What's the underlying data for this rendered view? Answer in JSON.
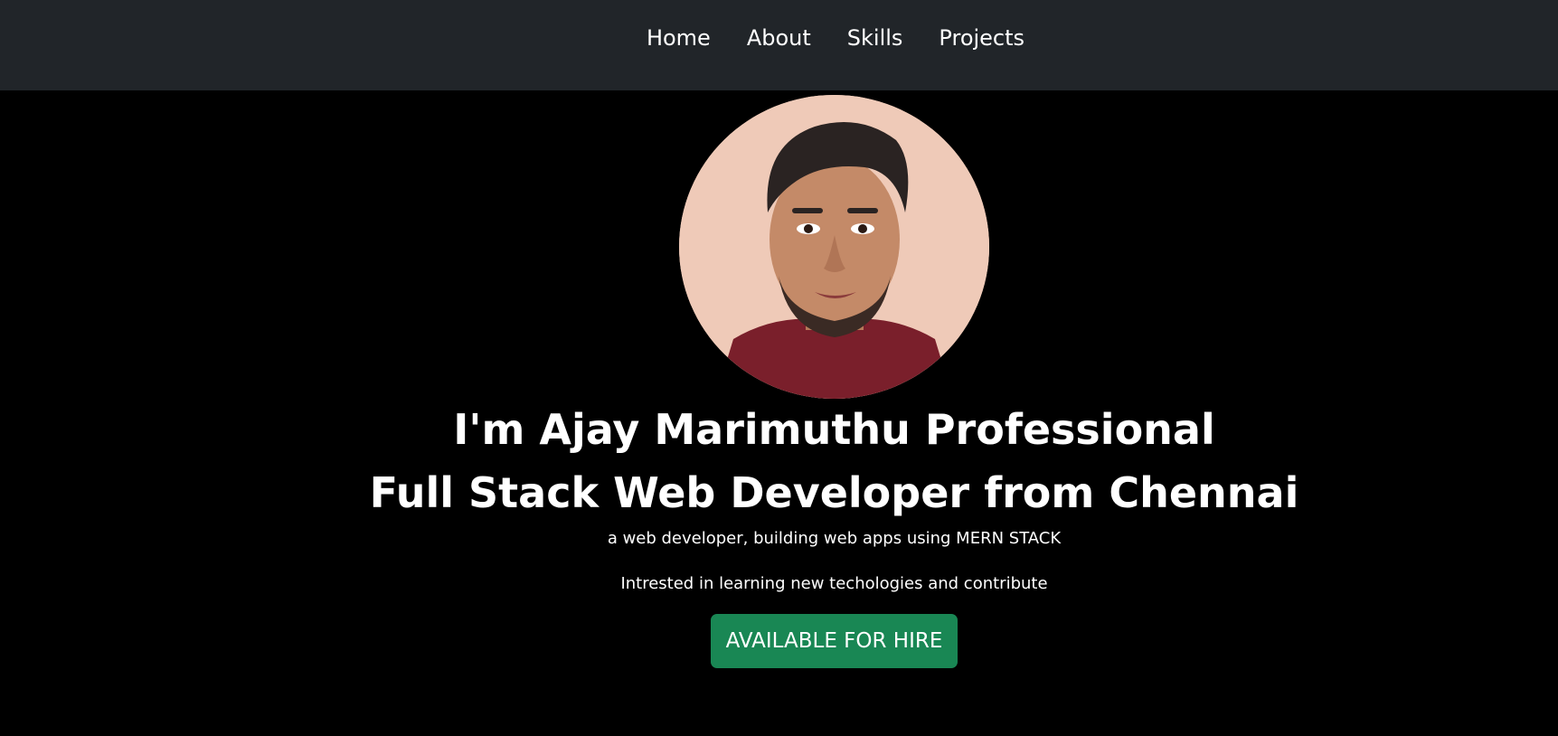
{
  "nav": {
    "items": [
      {
        "label": "Home"
      },
      {
        "label": "About"
      },
      {
        "label": "Skills"
      },
      {
        "label": "Projects"
      }
    ]
  },
  "hero": {
    "headline_line1": "I'm Ajay Marimuthu Professional",
    "headline_line2": "Full Stack Web Developer from Chennai",
    "tagline": "a web developer, building web apps using MERN STACK",
    "interest": "Intrested in learning new techologies and contribute",
    "cta_label": "AVAILABLE FOR HIRE"
  },
  "colors": {
    "navbar_bg": "#212529",
    "page_bg": "#000000",
    "cta_bg": "#198754"
  }
}
